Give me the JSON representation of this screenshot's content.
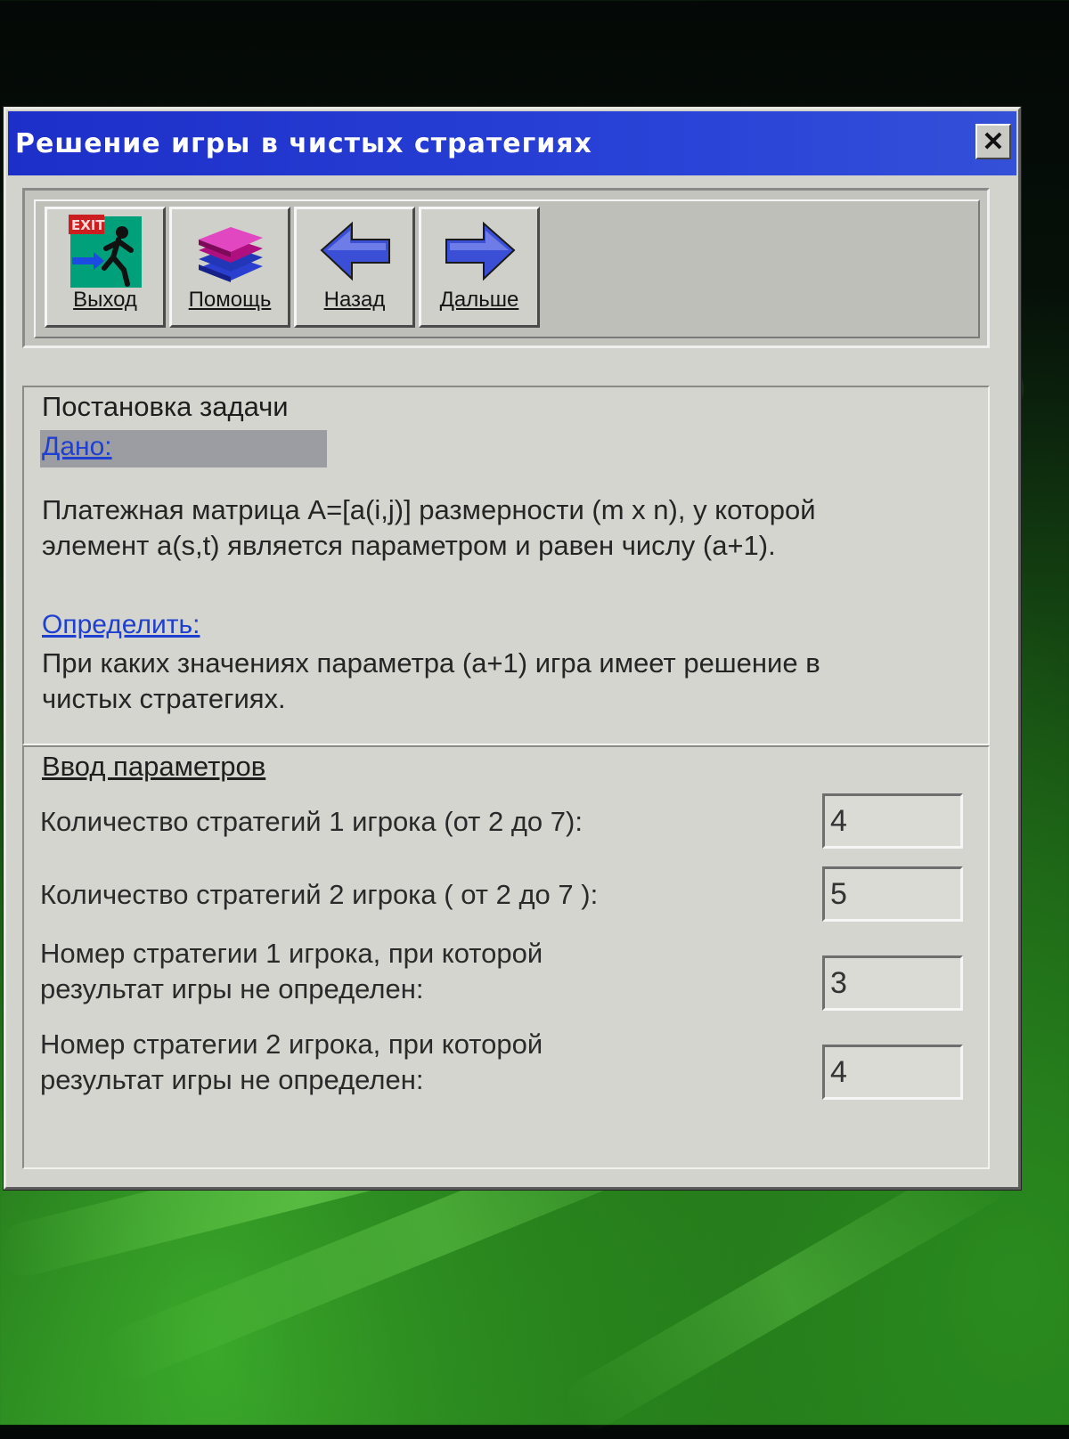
{
  "window": {
    "title": "Решение игры в чистых стратегиях",
    "close_label": "✕"
  },
  "toolbar": {
    "buttons": [
      {
        "label": "Выход",
        "icon": "exit-running-man-icon"
      },
      {
        "label": "Помощь",
        "icon": "books-stack-icon"
      },
      {
        "label": "Назад",
        "icon": "arrow-left-icon"
      },
      {
        "label": "Дальше",
        "icon": "arrow-right-icon"
      }
    ]
  },
  "problem": {
    "title": "Постановка задачи",
    "given_label": "Дано:",
    "given_text_1": "Платежная матрица A=[a(i,j)] размерности (m x n), у которой",
    "given_text_2": "элемент a(s,t) является параметром и равен числу (a+1).",
    "determine_label": "Определить:",
    "determine_text_1": "При каких значениях параметра (a+1) игра имеет решение в",
    "determine_text_2": "чистых стратегиях."
  },
  "params": {
    "title": "Ввод параметров",
    "rows": [
      {
        "label_1": "Количество стратегий 1 игрока (от 2 до 7):",
        "label_2": "",
        "value": "4"
      },
      {
        "label_1": "Количество стратегий 2 игрока ( от 2 до 7 ):",
        "label_2": "",
        "value": "5"
      },
      {
        "label_1": "Номер стратегии 1 игрока, при которой",
        "label_2": "результат игры не определен:",
        "value": "3"
      },
      {
        "label_1": "Номер стратегии 2 игрока, при которой",
        "label_2": "результат игры не определен:",
        "value": "4"
      }
    ]
  },
  "colors": {
    "titlebar": "#1d2fc9",
    "window_face": "#d2d3cc",
    "link": "#1f3fd0"
  }
}
